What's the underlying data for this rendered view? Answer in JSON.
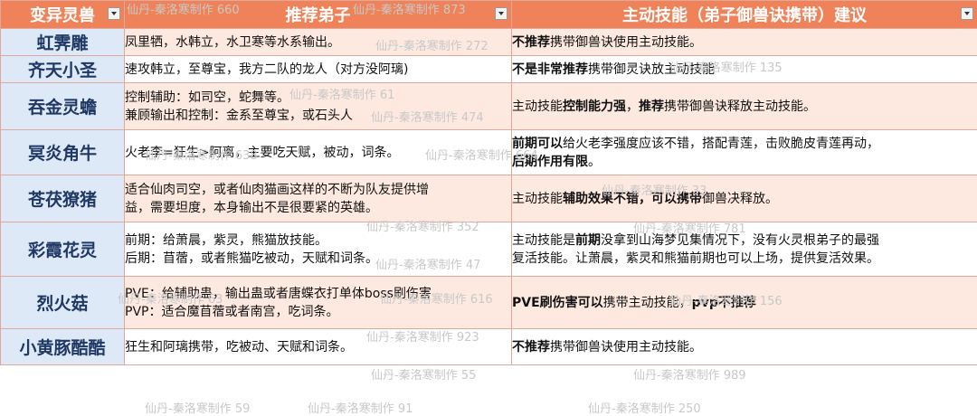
{
  "headers": [
    "变异灵兽",
    "推荐弟子",
    "主动技能（弟子御兽诀携带）建议"
  ],
  "rows": [
    {
      "beast": "虹霁雕",
      "disciples": [
        [
          {
            "t": "凤里牺，水韩立，水卫寒等水系输出。"
          }
        ]
      ],
      "skill": [
        [
          {
            "t": "不推荐",
            "b": true
          },
          {
            "t": "携带御兽诀使用主动技能。"
          }
        ]
      ]
    },
    {
      "beast": "齐天小圣",
      "disciples": [
        [
          {
            "t": "速攻韩立，至尊宝，我方二队的龙人（对方没阿璃)"
          }
        ]
      ],
      "skill": [
        [
          {
            "t": "不是非常推荐",
            "b": true
          },
          {
            "t": "携带御灵诀放主动技能"
          }
        ]
      ]
    },
    {
      "beast": "吞金灵蟾",
      "disciples": [
        [
          {
            "t": "控制辅助：如司空，蛇舞等。"
          }
        ],
        [
          {
            "t": "兼顾输出和控制：金系至尊宝，或石头人"
          }
        ]
      ],
      "skill": [
        [
          {
            "t": "主动技能"
          },
          {
            "t": "控制能力强",
            "b": true
          },
          {
            "t": "，"
          },
          {
            "t": "推荐",
            "b": true
          },
          {
            "t": "携带御兽诀释放主动技能。"
          }
        ]
      ]
    },
    {
      "beast": "冥炎角牛",
      "disciples": [
        [
          {
            "t": "火老李=狂生>阿离，主要吃天赋，被动，词条。"
          }
        ]
      ],
      "skill": [
        [
          {
            "t": "前期可以",
            "b": true
          },
          {
            "t": "给火老李强度应该不错，搭配青莲，击败脆皮青莲再动，"
          }
        ],
        [
          {
            "t": "后期作用有限",
            "b": true
          },
          {
            "t": "。"
          }
        ]
      ]
    },
    {
      "beast": "苍茯獠猪",
      "disciples": [
        [
          {
            "t": "适合仙肉司空，或者仙肉猫画这样的不断为队友提供增"
          }
        ],
        [
          {
            "t": "益，需要坦度，本身输出不是很要紧的英雄。"
          }
        ]
      ],
      "skill": [
        [
          {
            "t": "主动技能"
          },
          {
            "t": "辅助效果不错，可以携带",
            "b": true
          },
          {
            "t": "御兽决释放。"
          }
        ]
      ]
    },
    {
      "beast": "彩霞花灵",
      "disciples": [
        [
          {
            "t": "前期：给萧晨，紫灵，熊猫放技能。"
          }
        ],
        [
          {
            "t": "后期：苜蓿，或者熊猫吃被动，天赋和词条。"
          }
        ]
      ],
      "skill": [
        [
          {
            "t": "主动技能是"
          },
          {
            "t": "前期",
            "b": true
          },
          {
            "t": "没拿到山海梦见集情况下，没有火灵根弟子的最强"
          }
        ],
        [
          {
            "t": "复活技能。让萧晨，紫灵和熊猫前期也可以上场，提供复活效果。"
          }
        ]
      ]
    },
    {
      "beast": "烈火菇",
      "disciples": [
        [
          {
            "t": "PVE：给辅助蛊，输出蛊或者唐蝶衣打单体boss刷伤害"
          }
        ],
        [
          {
            "t": "PVP：适合魔苜蓿或者南宫，吃词条。"
          }
        ]
      ],
      "skill": [
        [
          {
            "t": "PVE刷伤害可以",
            "b": true
          },
          {
            "t": "携带主动技能，"
          },
          {
            "t": "pvp不推荐",
            "b": true
          }
        ]
      ]
    },
    {
      "beast": "小黄豚酷酷",
      "disciples": [
        [
          {
            "t": "狂生和阿璃携带，吃被动、天赋和词条。"
          }
        ]
      ],
      "skill": [
        [
          {
            "t": "不推荐",
            "b": true
          },
          {
            "t": "携带御兽诀使用主动技能。"
          }
        ]
      ]
    }
  ],
  "watermarks": [
    "仙丹-秦洛寒制作 660",
    "仙丹-秦洛寒制作 873",
    "仙丹-秦洛寒制作 272",
    "仙丹-秦洛寒制作 135",
    "仙丹-秦洛寒制作 61",
    "仙丹-秦洛寒制作 474",
    "仙丹-秦洛寒制作 638",
    "仙丹-秦洛寒制作 664",
    "仙丹-秦洛寒制作 33",
    "仙丹-秦洛寒制作 352",
    "仙丹-秦洛寒制作 781",
    "仙丹-秦洛寒制作 47",
    "仙丹-秦洛寒制作 63",
    "仙丹-秦洛寒制作 616",
    "仙丹-秦洛寒制作 156",
    "仙丹-秦洛寒制作 923",
    "仙丹-秦洛寒制作 55",
    "仙丹-秦洛寒制作 989",
    "仙丹-秦洛寒制作 59",
    "仙丹-秦洛寒制作 91",
    "仙丹-秦洛寒制作 250"
  ],
  "colors": {
    "header_bg": "#ef8258",
    "beast_bg": "#dde9f6",
    "beast_text": "#1f3864",
    "row_tint": "#fde9df"
  }
}
